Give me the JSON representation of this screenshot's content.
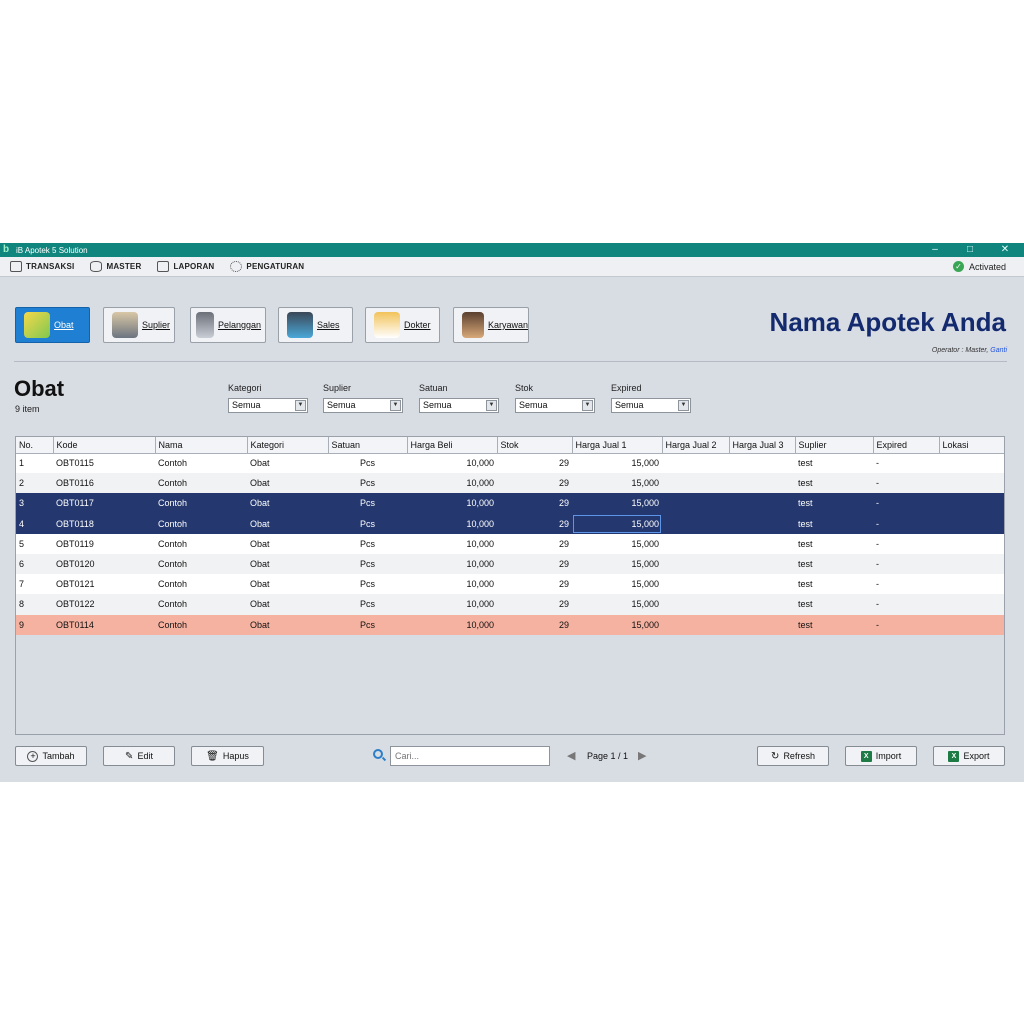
{
  "window": {
    "title": "iB Apotek 5 Solution",
    "minimize": "–",
    "maximize": "□",
    "close": "✕"
  },
  "menu": [
    {
      "label": "TRANSAKSI",
      "icon": "printer-icon"
    },
    {
      "label": "MASTER",
      "icon": "database-icon"
    },
    {
      "label": "LAPORAN",
      "icon": "report-icon"
    },
    {
      "label": "PENGATURAN",
      "icon": "gear-icon"
    }
  ],
  "status": {
    "activated": "Activated",
    "check": "✓"
  },
  "modules": [
    {
      "label": "Obat",
      "icon": "pill-icon",
      "active": true
    },
    {
      "label": "Suplier",
      "icon": "supplier-icon"
    },
    {
      "label": "Pelanggan",
      "icon": "customer-icon"
    },
    {
      "label": "Sales",
      "icon": "sales-icon"
    },
    {
      "label": "Dokter",
      "icon": "doctor-icon"
    },
    {
      "label": "Karyawan",
      "icon": "employee-icon"
    }
  ],
  "brand": {
    "name": "Nama Apotek Anda",
    "operator_prefix": "Operator : Master, ",
    "operator_link": "Ganti"
  },
  "page": {
    "title": "Obat",
    "count": "9 item"
  },
  "filters": [
    {
      "label": "Kategori",
      "value": "Semua"
    },
    {
      "label": "Suplier",
      "value": "Semua"
    },
    {
      "label": "Satuan",
      "value": "Semua"
    },
    {
      "label": "Stok",
      "value": "Semua"
    },
    {
      "label": "Expired",
      "value": "Semua"
    }
  ],
  "table": {
    "columns": [
      "No.",
      "Kode",
      "Nama",
      "Kategori",
      "Satuan",
      "Harga Beli",
      "Stok",
      "Harga Jual 1",
      "Harga Jual 2",
      "Harga Jual 3",
      "Suplier",
      "Expired",
      "Lokasi"
    ],
    "rows": [
      {
        "no": "1",
        "kode": "OBT0115",
        "nama": "Contoh",
        "kategori": "Obat",
        "satuan": "Pcs",
        "harga_beli": "10,000",
        "stok": "29",
        "harga_jual_1": "15,000",
        "harga_jual_2": "",
        "harga_jual_3": "",
        "suplier": "test",
        "expired": "-",
        "lokasi": "",
        "state": "normal"
      },
      {
        "no": "2",
        "kode": "OBT0116",
        "nama": "Contoh",
        "kategori": "Obat",
        "satuan": "Pcs",
        "harga_beli": "10,000",
        "stok": "29",
        "harga_jual_1": "15,000",
        "harga_jual_2": "",
        "harga_jual_3": "",
        "suplier": "test",
        "expired": "-",
        "lokasi": "",
        "state": "alt"
      },
      {
        "no": "3",
        "kode": "OBT0117",
        "nama": "Contoh",
        "kategori": "Obat",
        "satuan": "Pcs",
        "harga_beli": "10,000",
        "stok": "29",
        "harga_jual_1": "15,000",
        "harga_jual_2": "",
        "harga_jual_3": "",
        "suplier": "test",
        "expired": "-",
        "lokasi": "",
        "state": "selected"
      },
      {
        "no": "4",
        "kode": "OBT0118",
        "nama": "Contoh",
        "kategori": "Obat",
        "satuan": "Pcs",
        "harga_beli": "10,000",
        "stok": "29",
        "harga_jual_1": "15,000",
        "harga_jual_2": "",
        "harga_jual_3": "",
        "suplier": "test",
        "expired": "-",
        "lokasi": "",
        "state": "selected",
        "focus_col": "harga_jual_1"
      },
      {
        "no": "5",
        "kode": "OBT0119",
        "nama": "Contoh",
        "kategori": "Obat",
        "satuan": "Pcs",
        "harga_beli": "10,000",
        "stok": "29",
        "harga_jual_1": "15,000",
        "harga_jual_2": "",
        "harga_jual_3": "",
        "suplier": "test",
        "expired": "-",
        "lokasi": "",
        "state": "normal"
      },
      {
        "no": "6",
        "kode": "OBT0120",
        "nama": "Contoh",
        "kategori": "Obat",
        "satuan": "Pcs",
        "harga_beli": "10,000",
        "stok": "29",
        "harga_jual_1": "15,000",
        "harga_jual_2": "",
        "harga_jual_3": "",
        "suplier": "test",
        "expired": "-",
        "lokasi": "",
        "state": "alt"
      },
      {
        "no": "7",
        "kode": "OBT0121",
        "nama": "Contoh",
        "kategori": "Obat",
        "satuan": "Pcs",
        "harga_beli": "10,000",
        "stok": "29",
        "harga_jual_1": "15,000",
        "harga_jual_2": "",
        "harga_jual_3": "",
        "suplier": "test",
        "expired": "-",
        "lokasi": "",
        "state": "normal"
      },
      {
        "no": "8",
        "kode": "OBT0122",
        "nama": "Contoh",
        "kategori": "Obat",
        "satuan": "Pcs",
        "harga_beli": "10,000",
        "stok": "29",
        "harga_jual_1": "15,000",
        "harga_jual_2": "",
        "harga_jual_3": "",
        "suplier": "test",
        "expired": "-",
        "lokasi": "",
        "state": "alt"
      },
      {
        "no": "9",
        "kode": "OBT0114",
        "nama": "Contoh",
        "kategori": "Obat",
        "satuan": "Pcs",
        "harga_beli": "10,000",
        "stok": "29",
        "harga_jual_1": "15,000",
        "harga_jual_2": "",
        "harga_jual_3": "",
        "suplier": "test",
        "expired": "-",
        "lokasi": "",
        "state": "warning"
      }
    ]
  },
  "actions": {
    "add": "Tambah",
    "edit": "Edit",
    "delete": "Hapus",
    "refresh": "Refresh",
    "import": "Import",
    "export": "Export"
  },
  "search": {
    "placeholder": "Cari..."
  },
  "pagination": {
    "label": "Page 1 / 1",
    "prev": "◀",
    "next": "▶"
  },
  "colors": {
    "titlebar": "#10857e",
    "brand": "#142a6e",
    "selected_row": "#24386f",
    "warning_row": "#f6b2a1",
    "active_module": "#1f7fd3"
  }
}
